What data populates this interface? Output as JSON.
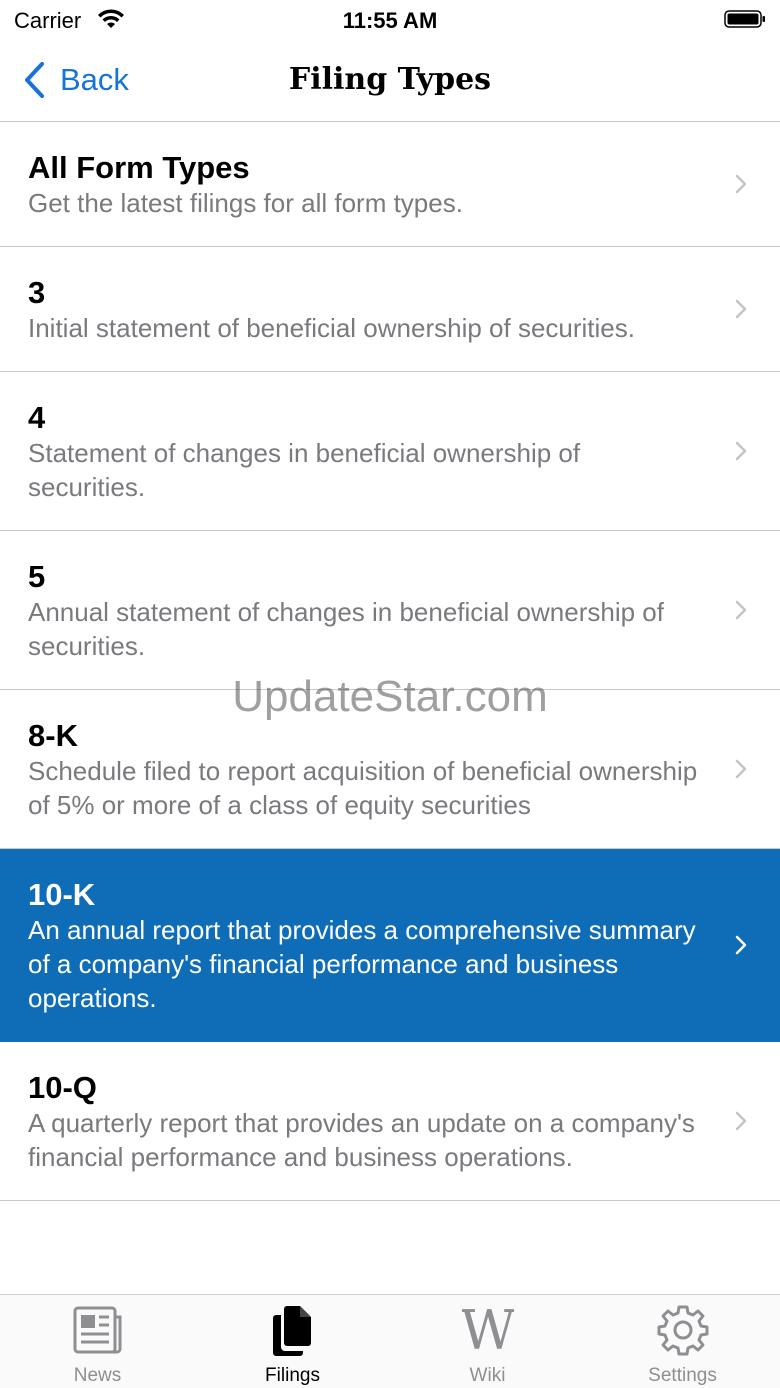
{
  "status_bar": {
    "carrier": "Carrier",
    "time": "11:55 AM"
  },
  "nav": {
    "back_label": "Back",
    "title": "Filing Types"
  },
  "rows": [
    {
      "title": "All Form Types",
      "description": "Get the latest filings for all form types."
    },
    {
      "title": "3",
      "description": "Initial statement of beneficial ownership of securities."
    },
    {
      "title": "4",
      "description": "Statement of changes in beneficial ownership of securities."
    },
    {
      "title": "5",
      "description": "Annual statement of changes in beneficial ownership of securities."
    },
    {
      "title": "8-K",
      "description": "Schedule filed to report acquisition of beneficial ownership of 5% or more of a class of equity securities"
    },
    {
      "title": "10-K",
      "description": "An annual report that provides a comprehensive summary of a company's financial performance and business operations.",
      "selected": true
    },
    {
      "title": "10-Q",
      "description": "A quarterly report that provides an update on a company's financial performance and business operations."
    }
  ],
  "watermark": "UpdateStar.com",
  "tabs": [
    {
      "label": "News",
      "icon": "newspaper-icon"
    },
    {
      "label": "Filings",
      "icon": "documents-icon",
      "active": true
    },
    {
      "label": "Wiki",
      "icon": "wikipedia-w-icon"
    },
    {
      "label": "Settings",
      "icon": "gear-icon"
    }
  ],
  "colors": {
    "accent": "#1673d9",
    "selected_row": "#0f6db8",
    "secondary_text": "#7a7a7e"
  }
}
